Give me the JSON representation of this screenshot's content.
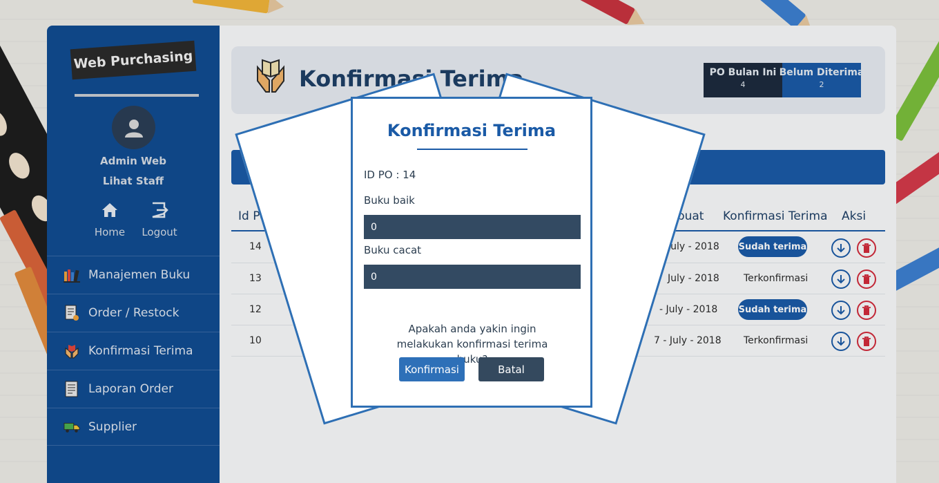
{
  "sidebar": {
    "brand": "Web Purchasing",
    "user_name": "Admin Web",
    "staff_link": "Lihat Staff",
    "quick_links": [
      {
        "label": "Home",
        "icon": "home-icon"
      },
      {
        "label": "Logout",
        "icon": "logout-icon"
      }
    ],
    "menu": [
      {
        "label": "Manajemen Buku",
        "icon": "books-icon"
      },
      {
        "label": "Order / Restock",
        "icon": "order-icon"
      },
      {
        "label": "Konfirmasi Terima",
        "icon": "hands-book-icon"
      },
      {
        "label": "Laporan Order",
        "icon": "report-icon"
      },
      {
        "label": "Supplier",
        "icon": "truck-icon"
      }
    ]
  },
  "header": {
    "title": "Konfirmasi Terima",
    "stats": [
      {
        "label": "PO Bulan Ini",
        "value": "4"
      },
      {
        "label": "Belum Diterima",
        "value": "2"
      }
    ]
  },
  "table": {
    "columns": [
      "Id Po",
      "Dibuat",
      "Konfirmasi Terima",
      "Aksi"
    ],
    "rows": [
      {
        "id": "14",
        "date": "July - 2018",
        "status": "Sudah terima",
        "status_type": "button"
      },
      {
        "id": "13",
        "date": "July - 2018",
        "status": "Terkonfirmasi",
        "status_type": "text"
      },
      {
        "id": "12",
        "date": "- July - 2018",
        "status": "Sudah terima",
        "status_type": "button"
      },
      {
        "id": "10",
        "date": "7 - July - 2018",
        "status": "Terkonfirmasi",
        "status_type": "text"
      }
    ]
  },
  "modal": {
    "title": "Konfirmasi Terima",
    "po_label": "ID PO : 14",
    "good_label": "Buku baik",
    "good_value": "0",
    "bad_label": "Buku cacat",
    "bad_value": "0",
    "question": "Apakah anda yakin ingin melakukan konfirmasi terima buku?",
    "confirm_label": "Konfirmasi",
    "cancel_label": "Batal"
  },
  "colors": {
    "sidebar": "#114c91",
    "primary": "#1a5aa6",
    "danger": "#d12a3b",
    "input": "#334a62"
  }
}
